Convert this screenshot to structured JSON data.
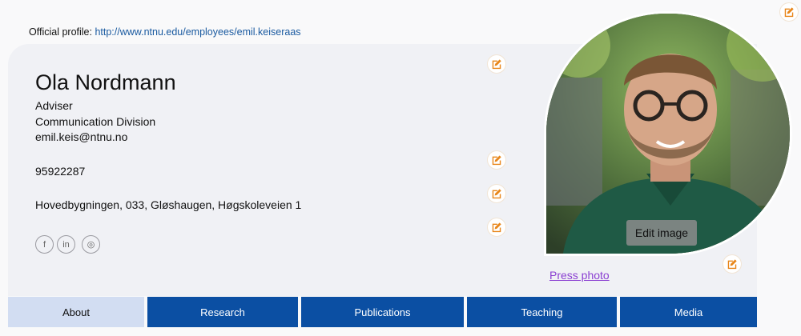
{
  "official_profile": {
    "label": "Official profile:",
    "url": "http://www.ntnu.edu/employees/emil.keiseraas"
  },
  "profile": {
    "name": "Ola Nordmann",
    "title": "Adviser",
    "division": "Communication Division",
    "email": "emil.keis@ntnu.no",
    "phone": "95922287",
    "address": "Hovedbygningen, 033, Gløshaugen, Høgskoleveien 1"
  },
  "social": [
    {
      "icon": "facebook-icon",
      "glyph": "f"
    },
    {
      "icon": "linkedin-icon",
      "glyph": "in"
    },
    {
      "icon": "instagram-icon",
      "glyph": "◎"
    }
  ],
  "photo": {
    "edit_label": "Edit image",
    "press_label": "Press photo"
  },
  "tabs": [
    {
      "label": "About",
      "active": true
    },
    {
      "label": "Research",
      "active": false
    },
    {
      "label": "Publications",
      "active": false
    },
    {
      "label": "Teaching",
      "active": false
    },
    {
      "label": "Media",
      "active": false
    }
  ],
  "colors": {
    "accent": "#e8861a",
    "tab_blue": "#0b4fa3",
    "tab_active": "#d2ddf2",
    "link": "#1a5aa0",
    "press_link": "#8a3fd1"
  }
}
